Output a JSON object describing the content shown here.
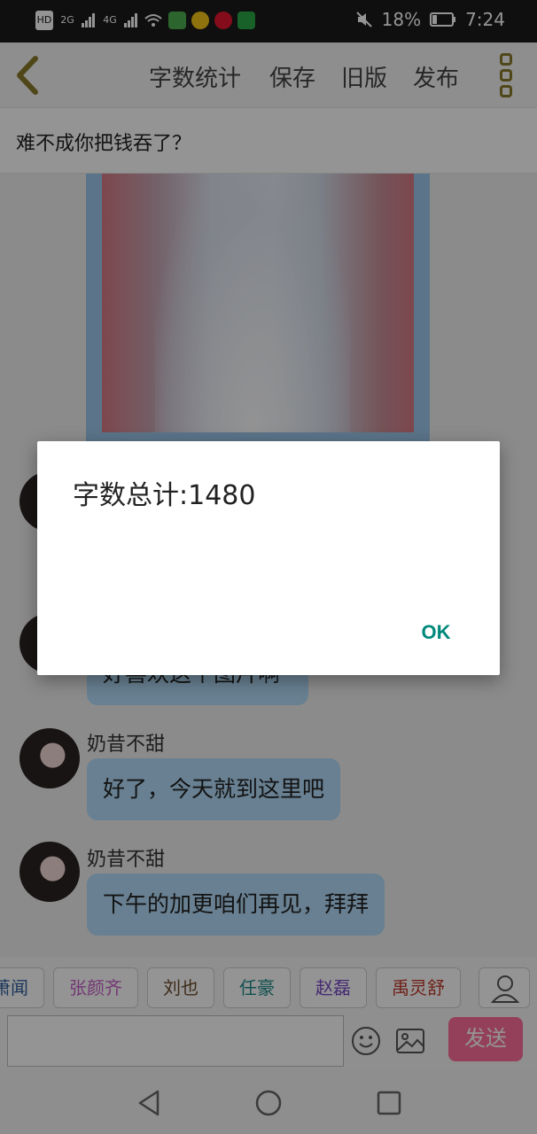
{
  "status_bar": {
    "left_labels": [
      "HD",
      "2G",
      "4G"
    ],
    "battery_percent": "18%",
    "time": "7:24"
  },
  "toolbar": {
    "word_count_label": "字数统计",
    "save_label": "保存",
    "old_version_label": "旧版",
    "publish_label": "发布"
  },
  "chapter": {
    "title": "难不成你把钱吞了？"
  },
  "messages": [
    {
      "sender": "",
      "text": "好喜欢这个图片啊"
    },
    {
      "sender": "奶昔不甜",
      "text": "好了，今天就到这里吧"
    },
    {
      "sender": "奶昔不甜",
      "text": "下午的加更咱们再见，拜拜"
    }
  ],
  "characters": [
    {
      "name": "萧闻",
      "color": "#2f5f9e"
    },
    {
      "name": "张颜齐",
      "color": "#c85fc8"
    },
    {
      "name": "刘也",
      "color": "#6b4a2a"
    },
    {
      "name": "任豪",
      "color": "#1f8a8a"
    },
    {
      "name": "赵磊",
      "color": "#7b4ac8"
    },
    {
      "name": "禹灵舒",
      "color": "#c0392b"
    }
  ],
  "composer": {
    "placeholder": "",
    "send_label": "发送"
  },
  "dialog": {
    "message": "字数总计:1480",
    "ok_label": "OK"
  }
}
